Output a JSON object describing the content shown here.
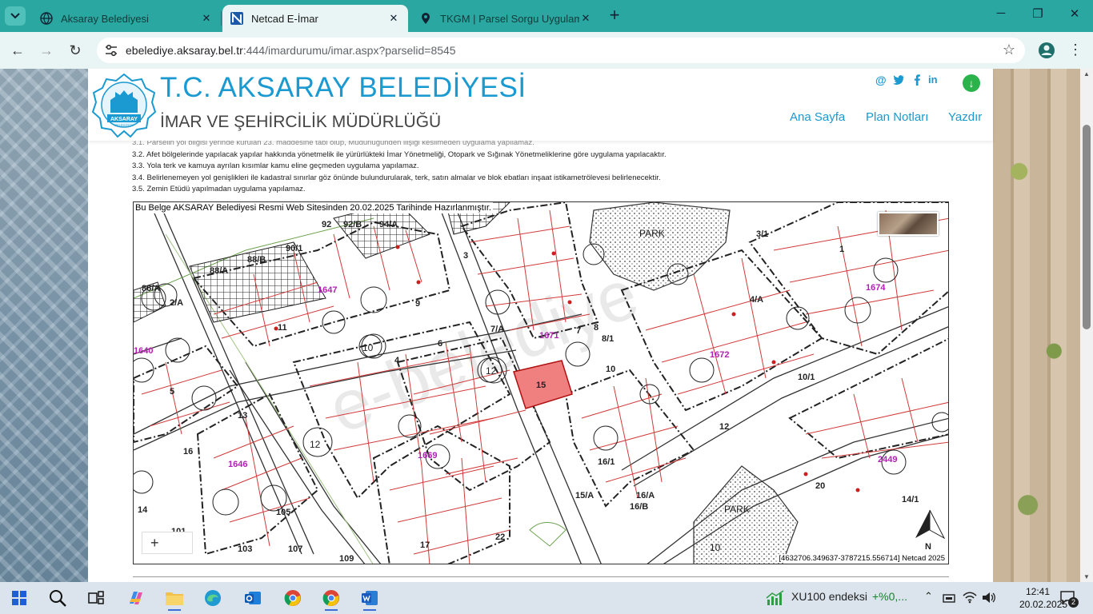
{
  "browser": {
    "tabs": [
      {
        "title": "Aksaray Belediyesi",
        "icon": "globe-icon",
        "active": false
      },
      {
        "title": "Netcad E-İmar",
        "icon": "netcad-icon",
        "active": true
      },
      {
        "title": "TKGM | Parsel Sorgu Uygulama",
        "icon": "map-pin-icon",
        "active": false
      }
    ],
    "new_tab_label": "+",
    "url_host": "ebelediye.aksaray.bel.tr",
    "url_rest": ":444/imardurumu/imar.aspx?parselid=8545"
  },
  "header": {
    "title": "T.C. AKSARAY BELEDİYESİ",
    "subtitle": "İMAR VE ŞEHİRCİLİK MÜDÜRLÜĞÜ",
    "logo_text": "AKSARAY",
    "logo_subtext": "BELEDİYESİ",
    "social": [
      "@",
      "twitter",
      "facebook",
      "linkedin"
    ],
    "nav": [
      "Ana Sayfa",
      "Plan Notları",
      "Yazdır"
    ]
  },
  "notes": [
    "3.1. Parselin yol bilgisi yerinde kurulan 23. maddesine tabi olup, Müdürlüğünden ilişiği kesilmeden uygulama yapılamaz.",
    "3.2. Afet bölgelerinde yapılacak yapılar hakkında yönetmelik ile yürürlükteki İmar Yönetmeliği, Otopark ve Sığınak Yönetmeliklerine göre uygulama yapılacaktır.",
    "3.3. Yola terk ve kamuya ayrılan kısımlar kamu eline geçmeden uygulama yapılamaz.",
    "3.4. Belirlenemeyen yol genişlikleri ile kadastral sınırlar göz önünde bulundurularak, terk, satın almalar ve blok ebatları inşaat istikametrölevesi belirlenecektir.",
    "3.5. Zemin Etüdü yapılmadan uygulama yapılamaz."
  ],
  "map": {
    "banner": "Bu Belge AKSARAY Belediyesi Resmi Web Sitesinden 20.02.2025 Tarihinde Hazırlanmıştır.",
    "coords": "[4632706.349637-3787215.556714] Netcad 2025",
    "zoom_in_label": "+",
    "north_label": "N",
    "park_label": "PARK",
    "watermark": "e-belediye",
    "selected_parcel": "15",
    "block_numbers": [
      "1647",
      "1671",
      "1672",
      "1674",
      "1646",
      "1669",
      "2449",
      "1640"
    ],
    "road_widths": [
      "12",
      "10",
      "12",
      "10"
    ],
    "parcel_numbers": [
      "92",
      "92/B",
      "94/A",
      "90/1",
      "88/B",
      "88/A",
      "86/A",
      "2/A",
      "3",
      "5",
      "9",
      "11",
      "13",
      "14",
      "16",
      "17",
      "22",
      "101",
      "103",
      "105",
      "107",
      "109",
      "4",
      "6",
      "7",
      "7/A",
      "8",
      "8/1",
      "10",
      "10/1",
      "12",
      "16/1",
      "16/A",
      "16/B",
      "15/A",
      "20",
      "14/1",
      "3/1",
      "4/A",
      "1"
    ],
    "accent_color": "#cc1f1f",
    "block_color": "#b21fb5"
  },
  "taskbar": {
    "items": [
      "start-icon",
      "search-icon",
      "task-view-icon",
      "copilot-icon",
      "file-explorer-icon",
      "edge-icon",
      "outlook-icon",
      "chrome-icon",
      "chrome-icon",
      "word-icon"
    ],
    "ticker_label": "XU100 endeksi",
    "ticker_value": "+%0,...",
    "time": "12:41",
    "date": "20.02.2025",
    "notification_count": "2"
  }
}
